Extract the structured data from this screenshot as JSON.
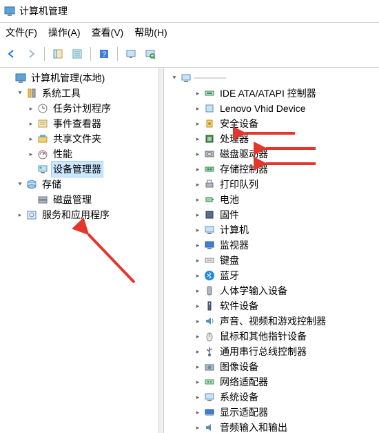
{
  "window": {
    "title": "计算机管理"
  },
  "menubar": {
    "file": "文件(F)",
    "action": "操作(A)",
    "view": "查看(V)",
    "help": "帮助(H)"
  },
  "left_tree": {
    "root": "计算机管理(本地)",
    "system_tools": "系统工具",
    "task_scheduler": "任务计划程序",
    "event_viewer": "事件查看器",
    "shared_folders": "共享文件夹",
    "performance": "性能",
    "device_manager": "设备管理器",
    "storage": "存储",
    "disk_management": "磁盘管理",
    "services_apps": "服务和应用程序"
  },
  "right_tree": {
    "root_device": "",
    "ide": "IDE ATA/ATAPI 控制器",
    "lenovo": "Lenovo Vhid Device",
    "security_devices": "安全设备",
    "processors": "处理器",
    "disk_drives": "磁盘驱动器",
    "storage_controllers": "存储控制器",
    "print_queues": "打印队列",
    "batteries": "电池",
    "firmware": "固件",
    "computer": "计算机",
    "monitors": "监视器",
    "keyboards": "键盘",
    "bluetooth": "蓝牙",
    "hid": "人体学输入设备",
    "software_devices": "软件设备",
    "sound": "声音、视频和游戏控制器",
    "mice": "鼠标和其他指针设备",
    "usb": "通用串行总线控制器",
    "imaging": "图像设备",
    "network": "网络适配器",
    "system_devices": "系统设备",
    "display": "显示适配器",
    "audio_io": "音频输入和输出"
  },
  "annotation_arrows": [
    {
      "target": "处理器"
    },
    {
      "target": "磁盘驱动器"
    },
    {
      "target": "存储控制器"
    }
  ]
}
